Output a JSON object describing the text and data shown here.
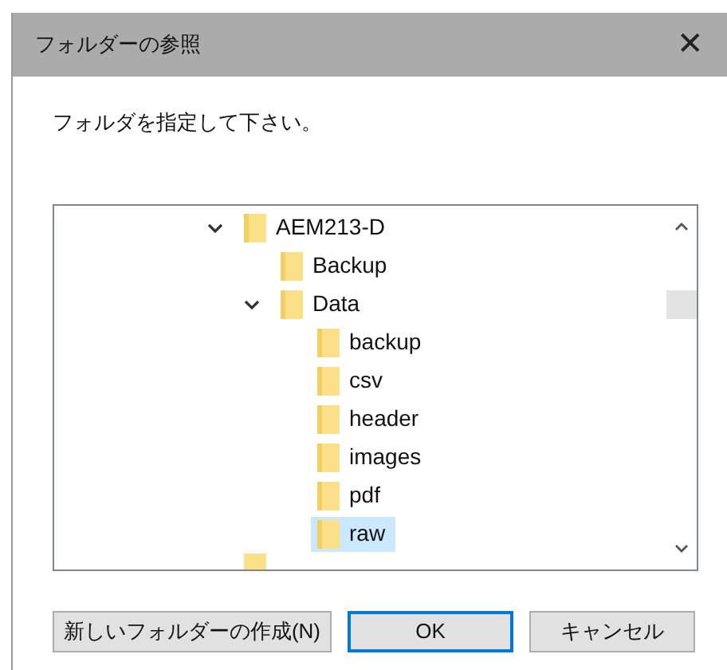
{
  "window": {
    "title": "フォルダーの参照",
    "close": "✕"
  },
  "prompt": "フォルダを指定して下さい。",
  "tree": [
    {
      "name": "AEM213-D",
      "expanded": true,
      "selected": false,
      "children": [
        {
          "name": "Backup",
          "expanded": false,
          "selected": false
        },
        {
          "name": "Data",
          "expanded": true,
          "selected": false,
          "children": [
            {
              "name": "backup",
              "expanded": false,
              "selected": false
            },
            {
              "name": "csv",
              "expanded": false,
              "selected": false
            },
            {
              "name": "header",
              "expanded": false,
              "selected": false
            },
            {
              "name": "images",
              "expanded": false,
              "selected": false
            },
            {
              "name": "pdf",
              "expanded": false,
              "selected": false
            },
            {
              "name": "raw",
              "expanded": false,
              "selected": true
            }
          ]
        }
      ]
    }
  ],
  "buttons": [
    {
      "label": "新しいフォルダーの作成(N)",
      "kind": "normal"
    },
    {
      "label": "OK",
      "kind": "default"
    },
    {
      "label": "キャンセル",
      "kind": "normal"
    }
  ]
}
